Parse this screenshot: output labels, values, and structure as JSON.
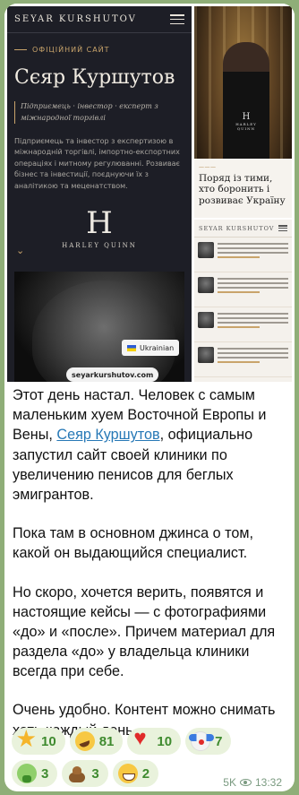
{
  "collage": {
    "left_screenshot": {
      "brand": "SEYAR KURSHUTOV",
      "kicker": "ОФІЦІЙНИЙ САЙТ",
      "name": "Сєяр Куршутов",
      "tagline": "Підприємець · інвестор · експерт з міжнародної торгівлі",
      "description": "Підприємець та інвестор з експертизою в міжнародній торгівлі, імпортно-експортних операціях і митному регулюванні. Розвиває бізнес та інвестиції, поєднуючи їх з аналітикою та меценатством.",
      "monogram": "H",
      "monogram_caption": "HARLEY QUINN",
      "language_label": "Ukrainian",
      "site_url": "seyarkurshutov.com"
    },
    "right_top_screenshot": {
      "monogram": "H",
      "monogram_caption": "HARLEY QUINN",
      "headline": "Поряд із тими, хто боронить і розвиває Україну"
    },
    "right_bottom_screenshot": {
      "brand": "SEYAR KURSHUTOV"
    }
  },
  "message": {
    "p1_before_link": "Этот день настал. Человек с самым маленьким хуем Восточной Европы и Вены, ",
    "link_text": "Сеяр Куршутов",
    "p1_after_link": ", официально запустил сайт своей клиники по увеличению пенисов для беглых эмигрантов.",
    "p2": "Пока там в основном джинса о том, какой он выдающийся специалист.",
    "p3": "Но скоро, хочется верить, появятся и настоящие кейсы — с фотографиями «до» и «после». Причем материал для раздела «до» у владельца клиники всегда при себе.",
    "p4": "Очень удобно. Контент можно снимать хоть каждый день."
  },
  "reactions": [
    {
      "icon": "star-emoji-icon",
      "count": "10"
    },
    {
      "icon": "rofl-emoji-icon",
      "count": "81"
    },
    {
      "icon": "heart-emoji-icon",
      "count": "10"
    },
    {
      "icon": "clown-emoji-icon",
      "count": "7"
    },
    {
      "icon": "vomit-emoji-icon",
      "count": "3"
    },
    {
      "icon": "poop-emoji-icon",
      "count": "3"
    },
    {
      "icon": "grin-emoji-icon",
      "count": "2"
    }
  ],
  "meta": {
    "views": "5K",
    "time": "13:32"
  },
  "colors": {
    "chat_background": "#8fae78",
    "bubble": "#ffffff",
    "link": "#2678b6",
    "reaction_pill": "#e9f2dc",
    "reaction_count": "#3e8a2e",
    "site_dark": "#1d1e26",
    "site_gold": "#c9a46b"
  }
}
